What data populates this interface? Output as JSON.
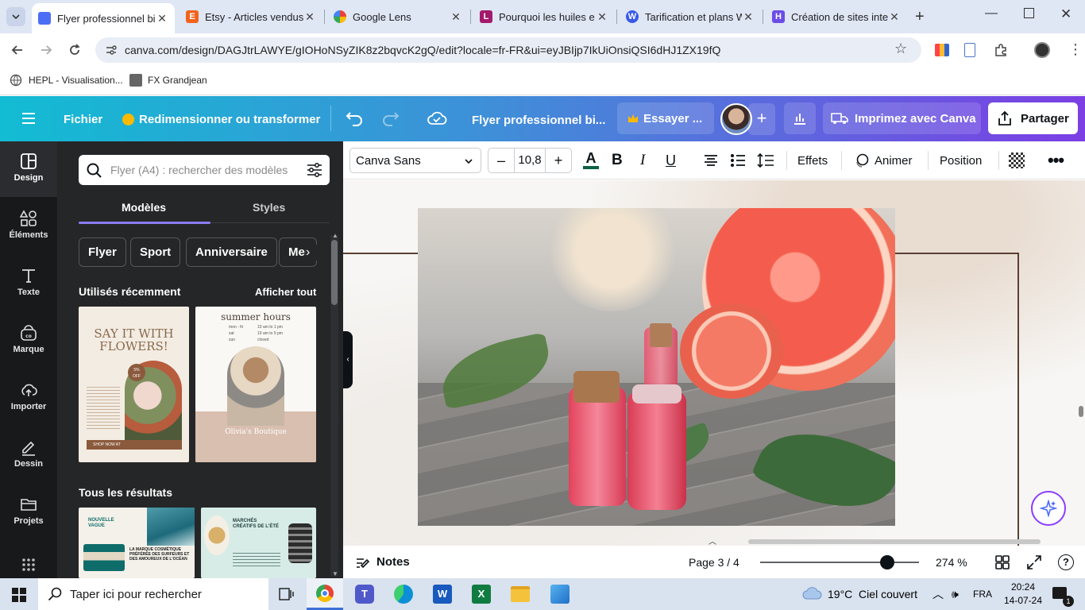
{
  "browser": {
    "tabs": [
      {
        "title": "Flyer professionnel bi",
        "icon": "canva-icon",
        "color": "#4c6ef5",
        "active": true
      },
      {
        "title": "Etsy - Articles vendus",
        "icon": "etsy-icon",
        "color": "#f1641e"
      },
      {
        "title": "Google Lens",
        "icon": "google-lens-icon",
        "color": "#4285f4"
      },
      {
        "title": "Pourquoi les huiles e",
        "icon": "l-icon",
        "color": "#a4196b"
      },
      {
        "title": "Tarification et plans W",
        "icon": "wordpress-icon",
        "color": "#3858e9"
      },
      {
        "title": "Création de sites inte",
        "icon": "site-builder-icon",
        "color": "#6b4de6"
      }
    ],
    "url": "canva.com/design/DAGJtrLAWYE/gIOHoNSyZIK8z2bqvcK2gQ/edit?locale=fr-FR&ui=eyJBIjp7IkUiOnsiQSI6dHJ1ZX19fQ",
    "bookmarks": [
      "HEPL - Visualisation...",
      "FX Grandjean"
    ]
  },
  "canva_header": {
    "menu_icon": "hamburger-icon",
    "file_label": "Fichier",
    "resize_label": "Redimensionner ou transformer",
    "design_title": "Flyer professionnel bi...",
    "try_label": "Essayer ...",
    "print_label": "Imprimez avec Canva",
    "share_label": "Partager"
  },
  "rail": {
    "items": [
      {
        "label": "Design",
        "icon": "design-icon"
      },
      {
        "label": "Éléments",
        "icon": "elements-icon"
      },
      {
        "label": "Texte",
        "icon": "text-icon"
      },
      {
        "label": "Marque",
        "icon": "brand-icon"
      },
      {
        "label": "Importer",
        "icon": "upload-icon"
      },
      {
        "label": "Dessin",
        "icon": "draw-icon"
      },
      {
        "label": "Projets",
        "icon": "folder-icon"
      }
    ]
  },
  "panel": {
    "search_placeholder": "Flyer (A4) : rechercher des modèles",
    "tabs": [
      "Modèles",
      "Styles"
    ],
    "chips": [
      "Flyer",
      "Sport",
      "Anniversaire",
      "Men"
    ],
    "recent_title": "Utilisés récemment",
    "see_all": "Afficher tout",
    "all_results": "Tous les résultats",
    "thumb1": {
      "line1": "SAY IT WITH",
      "line2": "FLOWERS!",
      "badge1": "5%",
      "badge2": "OFF",
      "cta": "SHOP NOW AT"
    },
    "thumb2": {
      "title": "summer hours",
      "rows": [
        "mon - fri",
        "sat",
        "sun"
      ],
      "times": [
        "10 am to 1 pm",
        "10 am to 5 pm",
        "closed"
      ],
      "brand": "Olivia's Boutique"
    },
    "thumb3": {
      "title1": "NOUVELLE",
      "title2": "VAGUE",
      "caption": "LA MARQUE COSMÉTIQUE PRÉFÉRÉE DES SURFEURS ET DES AMOUREUX DE L'OCÉAN"
    },
    "thumb4": {
      "title": "MARCHÉS CRÉATIFS DE L'ÉTÉ"
    }
  },
  "toolbar": {
    "font": "Canva Sans",
    "font_size": "10,8",
    "effects": "Effets",
    "animate": "Animer",
    "position": "Position"
  },
  "bottom": {
    "notes": "Notes",
    "page": "Page 3 / 4",
    "zoom": "274 %",
    "zoom_level": 0.8
  },
  "taskbar": {
    "search": "Taper ici pour rechercher",
    "weather": "19°C  Ciel couvert",
    "lang": "FRA",
    "time": "20:24",
    "date": "14-07-24",
    "notif_count": "1"
  }
}
